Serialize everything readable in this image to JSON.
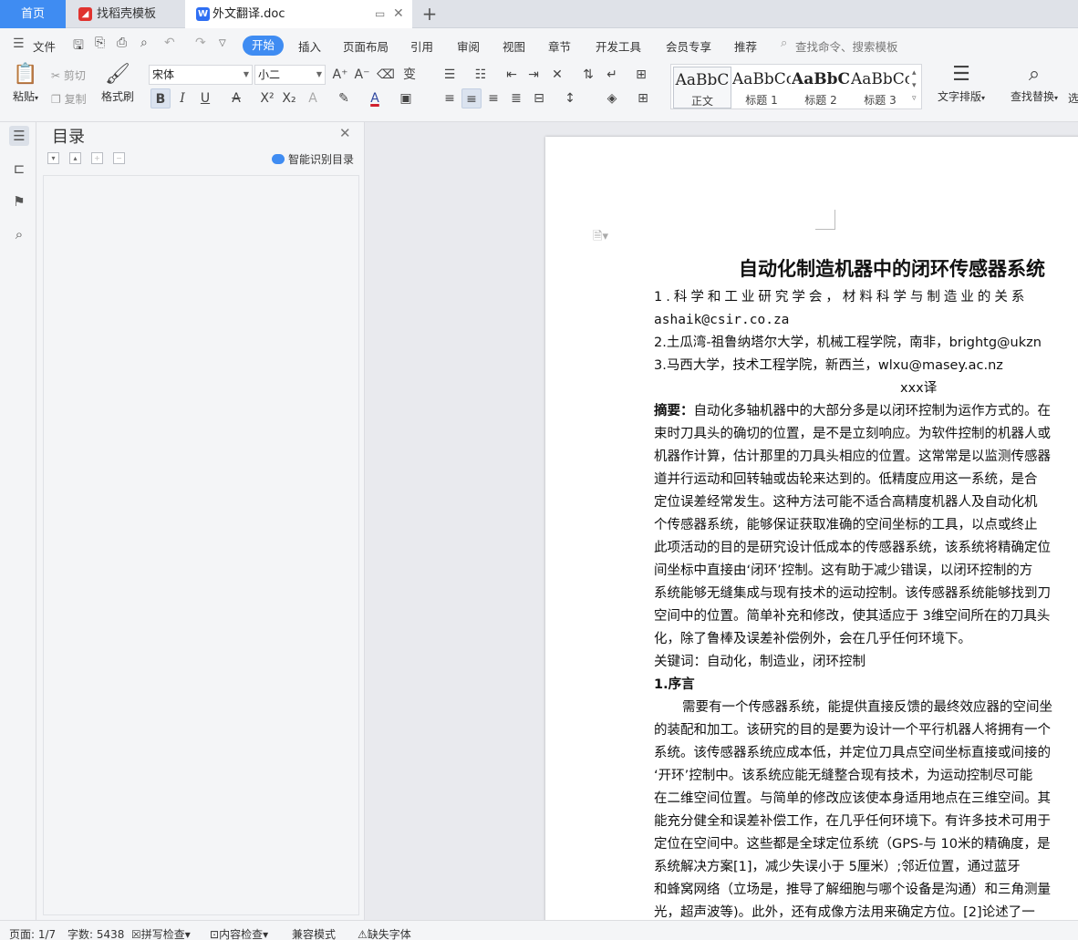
{
  "tabs": {
    "home": "首页",
    "daoke": "找稻壳模板",
    "daoke_icon": "daoke-logo-icon",
    "doc": "外文翻译.doc",
    "doc_icon": "writer-logo-icon"
  },
  "menu": {
    "file": "文件",
    "active": "开始",
    "items": [
      "插入",
      "页面布局",
      "引用",
      "审阅",
      "视图",
      "章节",
      "开发工具",
      "会员专享",
      "推荐"
    ],
    "search_placeholder": "查找命令、搜索模板"
  },
  "ribbon": {
    "paste": "粘贴",
    "cut": "剪切",
    "copy": "复制",
    "format_painter": "格式刷",
    "font_name": "宋体",
    "font_size": "小二",
    "styles": [
      {
        "sample": "AaBbC",
        "name": "正文"
      },
      {
        "sample": "AaBbCc",
        "name": "标题 1"
      },
      {
        "sample": "AaBbCc",
        "name": "标题 2"
      },
      {
        "sample": "AaBbCcI",
        "name": "标题 3"
      }
    ],
    "text_layout": "文字排版",
    "find_replace": "查找替换",
    "select_more": "选"
  },
  "toc": {
    "title": "目录",
    "smart": "智能识别目录"
  },
  "document": {
    "title": "自动化制造机器中的闭环传感器系统",
    "affil1": "1.科学和工业研究学会，材料科学与制造业的关系",
    "email1": "ashaik@csir.co.za",
    "affil2": "2.土瓜湾-祖鲁纳塔尔大学，机械工程学院，南非，brightg@ukzn",
    "affil3": "3.马西大学，技术工程学院，新西兰，wlxu@masey.ac.nz",
    "translator": "xxx译",
    "abstract_label": "摘要：",
    "abstract_lines": [
      "自动化多轴机器中的大部分多是以闭环控制为运作方式的。在",
      "束时刀具头的确切的位置，是不是立刻响应。为软件控制的机器人或",
      "机器作计算，估计那里的刀具头相应的位置。这常常是以监测传感器",
      "道并行运动和回转轴或齿轮来达到的。低精度应用这一系统，是合",
      "定位误差经常发生。这种方法可能不适合高精度机器人及自动化机",
      "个传感器系统，能够保证获取准确的空间坐标的工具，以点或终止",
      "此项活动的目的是研究设计低成本的传感器系统，该系统将精确定位",
      "间坐标中直接由‘闭环’控制。这有助于减少错误，以闭环控制的方",
      "系统能够无缝集成与现有技术的运动控制。该传感器系统能够找到刀",
      "空间中的位置。简单补充和修改，使其适应于 3维空间所在的刀具头",
      "化，除了鲁棒及误差补偿例外，会在几乎任何环境下。"
    ],
    "keywords": "关键词：自动化，制造业，闭环控制",
    "section1": "1.序言",
    "intro_lines": [
      "需要有一个传感器系统，能提供直接反馈的最终效应器的空间坐",
      "的装配和加工。该研究的目的是要为设计一个平行机器人将拥有一个",
      "系统。该传感器系统应成本低，并定位刀具点空间坐标直接或间接的",
      "‘开环’控制中。该系统应能无缝整合现有技术，为运动控制尽可能",
      "在二维空间位置。与简单的修改应该使本身适用地点在三维空间。其",
      "能充分健全和误差补偿工作，在几乎任何环境下。有许多技术可用于",
      "定位在空间中。这些都是全球定位系统（GPS-与 10米的精确度，是",
      "系统解决方案[1]，减少失误小于 5厘米）;邻近位置，通过蓝牙",
      "和蜂窝网络（立场是，推导了解细胞与哪个设备是沟通）和三角测量",
      "光，超声波等)。此外，还有成像方法用来确定方位。[2]论述了一"
    ]
  },
  "status": {
    "page": "页面: 1/7",
    "words": "字数: 5438",
    "spell": "拼写检查",
    "content": "内容检查",
    "compat": "兼容模式",
    "missing_font": "缺失字体"
  },
  "colors": {
    "accent": "#3f8cf2",
    "font_color": "#d0202e"
  }
}
